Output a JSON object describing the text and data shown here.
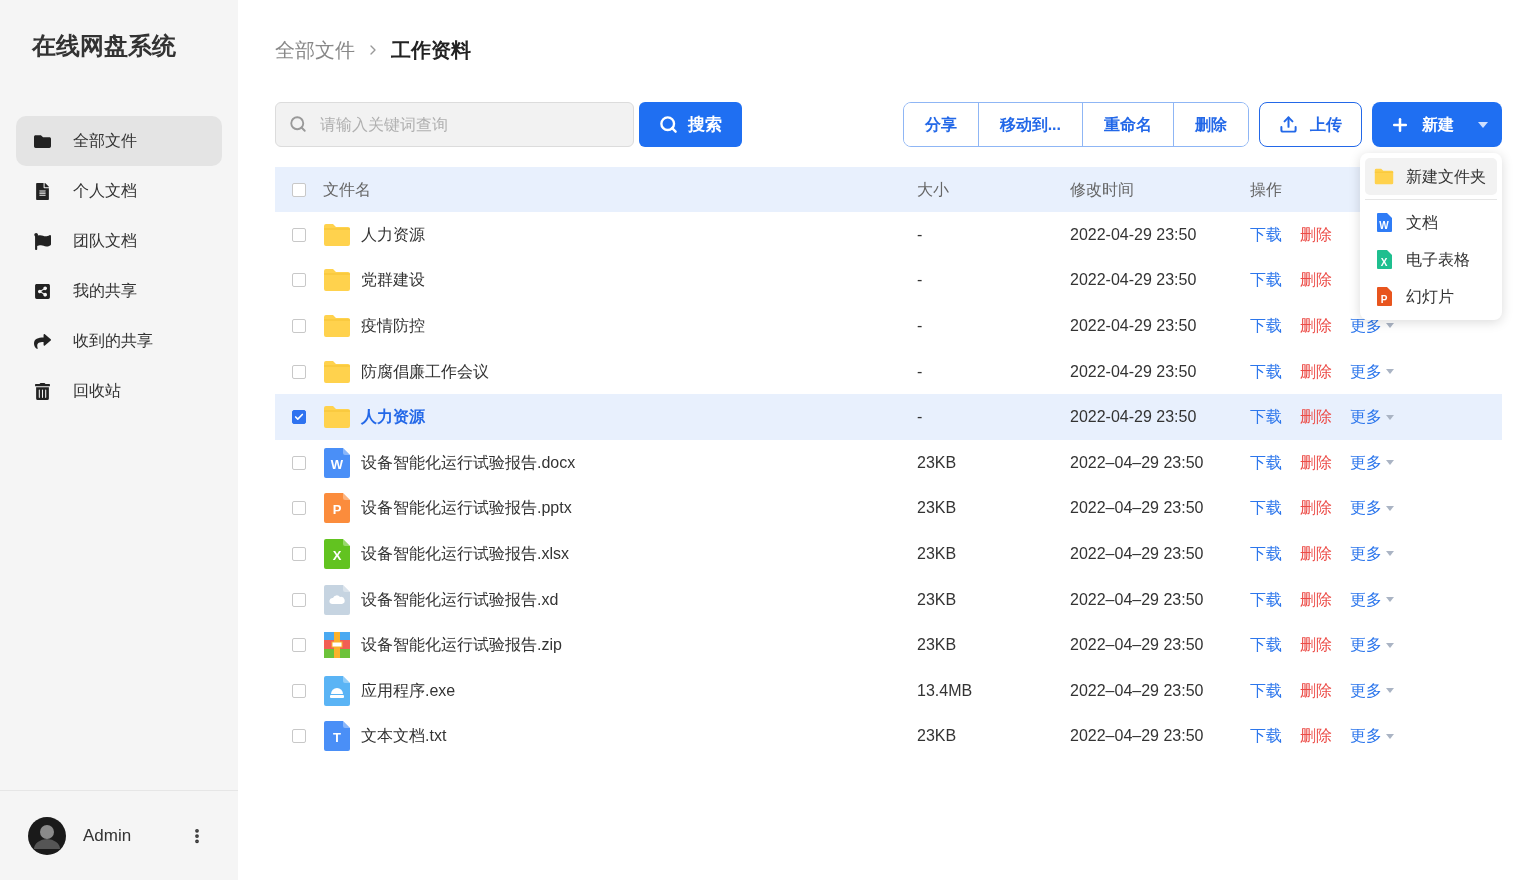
{
  "app_title": "在线网盘系统",
  "sidebar": {
    "items": [
      {
        "label": "全部文件",
        "selected": true
      },
      {
        "label": "个人文档",
        "selected": false
      },
      {
        "label": "团队文档",
        "selected": false
      },
      {
        "label": "我的共享",
        "selected": false
      },
      {
        "label": "收到的共享",
        "selected": false
      },
      {
        "label": "回收站",
        "selected": false
      }
    ],
    "user": {
      "name": "Admin"
    }
  },
  "breadcrumb": [
    {
      "label": "全部文件",
      "current": false
    },
    {
      "label": "工作资料",
      "current": true
    }
  ],
  "search": {
    "placeholder": "请输入关键词查询",
    "button": "搜索"
  },
  "actions_group": [
    "分享",
    "移动到...",
    "重命名",
    "删除"
  ],
  "upload_button": "上传",
  "new_button": "新建",
  "new_menu": [
    {
      "label": "新建文件夹",
      "kind": "folder",
      "selected": true
    },
    {
      "label": "文档",
      "kind": "word",
      "icon_letter": "W",
      "selected": false
    },
    {
      "label": "电子表格",
      "kind": "excel",
      "icon_letter": "X",
      "selected": false
    },
    {
      "label": "幻灯片",
      "kind": "ppt",
      "icon_letter": "P",
      "selected": false
    }
  ],
  "table": {
    "columns": [
      "文件名",
      "大小",
      "修改时间",
      "操作"
    ],
    "all_checked": false,
    "rows": [
      {
        "kind": "folder",
        "name": "人力资源",
        "size": "-",
        "modified": "2022-04-29 23:50",
        "checked": false,
        "actions": [
          {
            "kind": "download",
            "label": "下载"
          },
          {
            "kind": "delete",
            "label": "删除"
          }
        ]
      },
      {
        "kind": "folder",
        "name": "党群建设",
        "size": "-",
        "modified": "2022-04-29 23:50",
        "checked": false,
        "actions": [
          {
            "kind": "download",
            "label": "下载"
          },
          {
            "kind": "delete",
            "label": "删除"
          }
        ]
      },
      {
        "kind": "folder",
        "name": "疫情防控",
        "size": "-",
        "modified": "2022-04-29 23:50",
        "checked": false,
        "actions": [
          {
            "kind": "download",
            "label": "下载"
          },
          {
            "kind": "delete",
            "label": "删除"
          },
          {
            "kind": "more",
            "label": "更多",
            "caret": true
          }
        ]
      },
      {
        "kind": "folder",
        "name": "防腐倡廉工作会议",
        "size": "-",
        "modified": "2022-04-29 23:50",
        "checked": false,
        "actions": [
          {
            "kind": "download",
            "label": "下载"
          },
          {
            "kind": "delete",
            "label": "删除"
          },
          {
            "kind": "more",
            "label": "更多",
            "caret": true
          }
        ]
      },
      {
        "kind": "folder",
        "name": "人力资源",
        "size": "-",
        "modified": "2022-04-29 23:50",
        "checked": true,
        "actions": [
          {
            "kind": "download",
            "label": "下载"
          },
          {
            "kind": "delete",
            "label": "删除"
          },
          {
            "kind": "more",
            "label": "更多",
            "caret": true
          }
        ]
      },
      {
        "kind": "word",
        "icon_letter": "W",
        "name": "设备智能化运行试验报告.docx",
        "size": "23KB",
        "modified": "2022–04–29 23:50",
        "checked": false,
        "actions": [
          {
            "kind": "download",
            "label": "下载"
          },
          {
            "kind": "delete",
            "label": "删除"
          },
          {
            "kind": "more",
            "label": "更多",
            "caret": true
          }
        ]
      },
      {
        "kind": "ppt",
        "icon_letter": "P",
        "name": "设备智能化运行试验报告.pptx",
        "size": "23KB",
        "modified": "2022–04–29 23:50",
        "checked": false,
        "actions": [
          {
            "kind": "download",
            "label": "下载"
          },
          {
            "kind": "delete",
            "label": "删除"
          },
          {
            "kind": "more",
            "label": "更多",
            "caret": true
          }
        ]
      },
      {
        "kind": "excel",
        "icon_letter": "X",
        "name": "设备智能化运行试验报告.xlsx",
        "size": "23KB",
        "modified": "2022–04–29 23:50",
        "checked": false,
        "actions": [
          {
            "kind": "download",
            "label": "下载"
          },
          {
            "kind": "delete",
            "label": "删除"
          },
          {
            "kind": "more",
            "label": "更多",
            "caret": true
          }
        ]
      },
      {
        "kind": "xd",
        "name": "设备智能化运行试验报告.xd",
        "size": "23KB",
        "modified": "2022–04–29 23:50",
        "checked": false,
        "actions": [
          {
            "kind": "download",
            "label": "下载"
          },
          {
            "kind": "delete",
            "label": "删除"
          },
          {
            "kind": "more",
            "label": "更多",
            "caret": true
          }
        ]
      },
      {
        "kind": "zip",
        "name": "设备智能化运行试验报告.zip",
        "size": "23KB",
        "modified": "2022–04–29 23:50",
        "checked": false,
        "actions": [
          {
            "kind": "download",
            "label": "下载"
          },
          {
            "kind": "delete",
            "label": "删除"
          },
          {
            "kind": "more",
            "label": "更多",
            "caret": true
          }
        ]
      },
      {
        "kind": "exe",
        "name": "应用程序.exe",
        "size": "13.4MB",
        "modified": "2022–04–29 23:50",
        "checked": false,
        "actions": [
          {
            "kind": "download",
            "label": "下载"
          },
          {
            "kind": "delete",
            "label": "删除"
          },
          {
            "kind": "more",
            "label": "更多",
            "caret": true
          }
        ]
      },
      {
        "kind": "txt",
        "icon_letter": "T",
        "name": "文本文档.txt",
        "size": "23KB",
        "modified": "2022–04–29 23:50",
        "checked": false,
        "actions": [
          {
            "kind": "download",
            "label": "下载"
          },
          {
            "kind": "delete",
            "label": "删除"
          },
          {
            "kind": "more",
            "label": "更多",
            "caret": true
          }
        ]
      }
    ]
  }
}
